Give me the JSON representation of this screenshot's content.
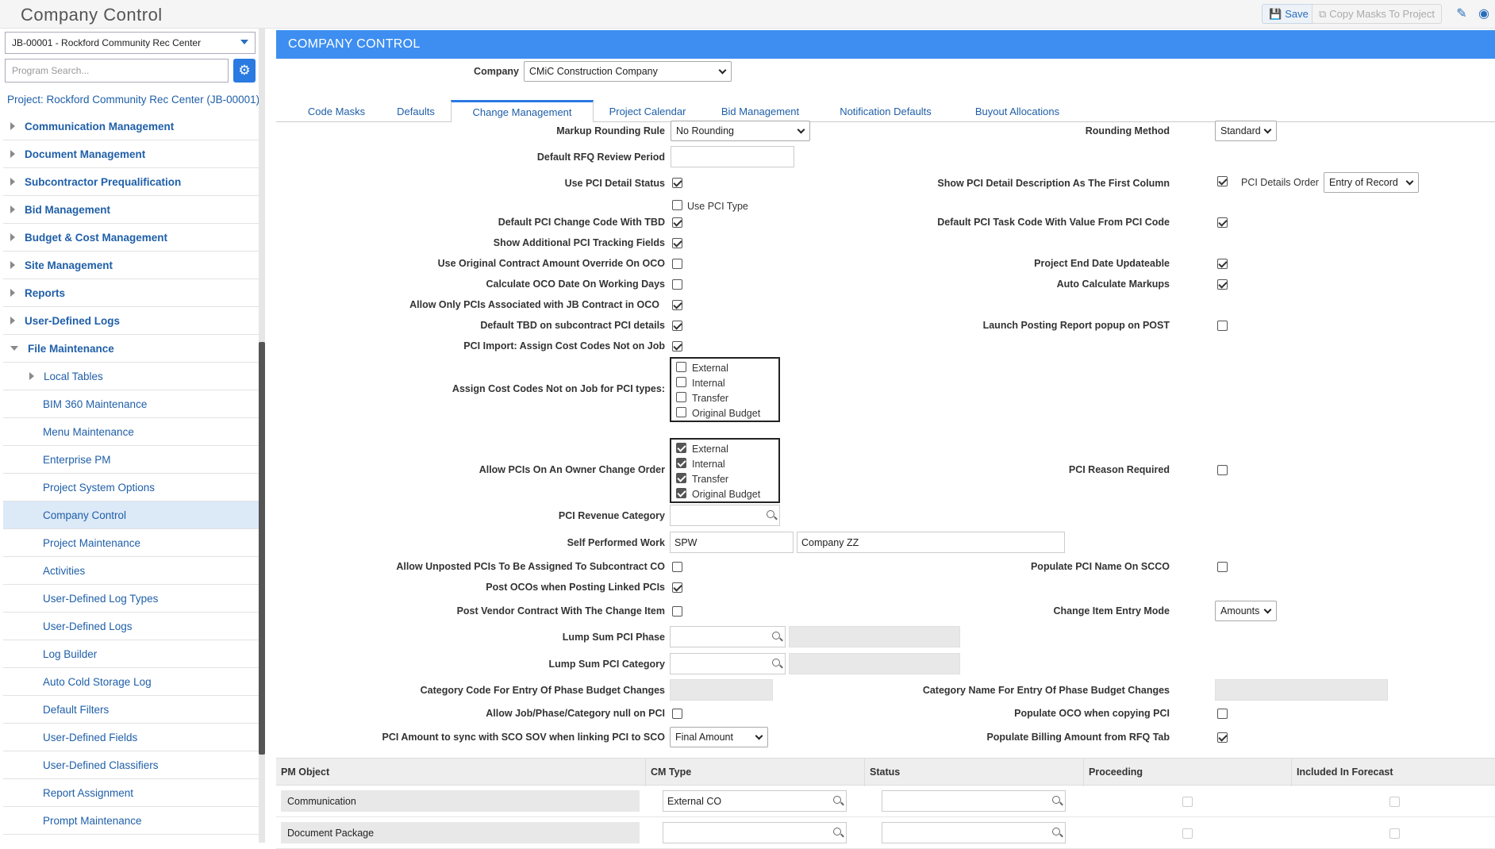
{
  "app": {
    "title": "Company Control",
    "save_label": "Save",
    "copy_masks_label": "Copy Masks To Project"
  },
  "sidebar": {
    "project_select": "JB-00001 - Rockford Community Rec Center",
    "search_placeholder": "Program Search...",
    "project_link": "Project: Rockford Community Rec Center (JB-00001)",
    "items": [
      {
        "label": "Communication Management"
      },
      {
        "label": "Document Management"
      },
      {
        "label": "Subcontractor Prequalification"
      },
      {
        "label": "Bid Management"
      },
      {
        "label": "Budget & Cost Management"
      },
      {
        "label": "Site Management"
      },
      {
        "label": "Reports"
      },
      {
        "label": "User-Defined Logs"
      },
      {
        "label": "File Maintenance"
      }
    ],
    "sub_items": [
      {
        "label": "Local Tables"
      },
      {
        "label": "BIM 360 Maintenance"
      },
      {
        "label": "Menu Maintenance"
      },
      {
        "label": "Enterprise PM"
      },
      {
        "label": "Project System Options"
      },
      {
        "label": "Company Control"
      },
      {
        "label": "Project Maintenance"
      },
      {
        "label": "Activities"
      },
      {
        "label": "User-Defined Log Types"
      },
      {
        "label": "User-Defined Logs"
      },
      {
        "label": "Log Builder"
      },
      {
        "label": "Auto Cold Storage Log"
      },
      {
        "label": "Default Filters"
      },
      {
        "label": "User-Defined Fields"
      },
      {
        "label": "User-Defined Classifiers"
      },
      {
        "label": "Report Assignment"
      },
      {
        "label": "Prompt Maintenance"
      }
    ]
  },
  "main": {
    "header": "COMPANY CONTROL",
    "company_label": "Company",
    "company_value": "CMiC Construction Company",
    "tabs": [
      "Code Masks",
      "Defaults",
      "Change Management",
      "Project Calendar",
      "Bid Management",
      "Notification Defaults",
      "Buyout Allocations"
    ],
    "fields": {
      "markup_rounding_rule": {
        "label": "Markup Rounding Rule",
        "value": "No Rounding"
      },
      "rounding_method": {
        "label": "Rounding Method",
        "value": "Standard"
      },
      "default_rfq_review_period": {
        "label": "Default RFQ Review Period"
      },
      "use_pci_detail_status": {
        "label": "Use PCI Detail Status"
      },
      "show_pci_detail_desc": {
        "label": "Show PCI Detail Description As The First Column"
      },
      "pci_details_order": {
        "label": "PCI Details Order",
        "value": "Entry of Record"
      },
      "use_pci_type": {
        "label": "Use PCI Type"
      },
      "default_pci_change_code_tbd": {
        "label": "Default PCI Change Code With TBD"
      },
      "default_pci_task_code": {
        "label": "Default PCI Task Code With Value From PCI Code"
      },
      "show_additional_pci_tracking": {
        "label": "Show Additional PCI Tracking Fields"
      },
      "use_original_contract_amount": {
        "label": "Use Original Contract Amount Override On OCO"
      },
      "project_end_date_updateable": {
        "label": "Project End Date Updateable"
      },
      "calculate_oco_date": {
        "label": "Calculate OCO Date On Working Days"
      },
      "auto_calculate_markups": {
        "label": "Auto Calculate Markups"
      },
      "allow_only_pcis_jb": {
        "label": "Allow Only PCIs Associated with JB Contract in OCO"
      },
      "default_tbd_subcontract": {
        "label": "Default TBD on subcontract PCI details"
      },
      "launch_posting_report": {
        "label": "Launch Posting Report popup on POST"
      },
      "pci_import_assign": {
        "label": "PCI Import: Assign Cost Codes Not on Job"
      },
      "assign_cost_codes_types": {
        "label": "Assign Cost Codes Not on Job for PCI types:"
      },
      "allow_pcis_owner_change": {
        "label": "Allow PCIs On An Owner Change Order"
      },
      "pci_reason_required": {
        "label": "PCI Reason Required"
      },
      "pci_revenue_category": {
        "label": "PCI Revenue Category"
      },
      "self_performed_work": {
        "label": "Self Performed Work",
        "code": "SPW",
        "name": "Company ZZ"
      },
      "allow_unposted_pcis": {
        "label": "Allow Unposted PCIs To Be Assigned To Subcontract CO"
      },
      "populate_pci_name_scco": {
        "label": "Populate PCI Name On SCCO"
      },
      "post_ocos_linked": {
        "label": "Post OCOs when Posting Linked PCIs"
      },
      "post_vendor_contract": {
        "label": "Post Vendor Contract With The Change Item"
      },
      "change_item_entry_mode": {
        "label": "Change Item Entry Mode",
        "value": "Amounts"
      },
      "lump_sum_pci_phase": {
        "label": "Lump Sum PCI Phase"
      },
      "lump_sum_pci_category": {
        "label": "Lump Sum PCI Category"
      },
      "category_code_entry": {
        "label": "Category Code For Entry Of Phase Budget Changes"
      },
      "category_name_entry": {
        "label": "Category Name For Entry Of Phase Budget Changes"
      },
      "allow_job_phase_null": {
        "label": "Allow Job/Phase/Category null on PCI"
      },
      "populate_oco_copying": {
        "label": "Populate OCO when copying PCI"
      },
      "pci_amount_sync": {
        "label": "PCI Amount to sync with SCO SOV when linking PCI to SCO",
        "value": "Final Amount"
      },
      "populate_billing_amount": {
        "label": "Populate Billing Amount from RFQ Tab"
      }
    },
    "pci_types": [
      "External",
      "Internal",
      "Transfer",
      "Original Budget"
    ],
    "grid": {
      "columns": [
        "PM Object",
        "CM Type",
        "Status",
        "Proceeding",
        "Included In Forecast"
      ],
      "rows": [
        {
          "pm_object": "Communication",
          "cm_type": "External CO",
          "status": ""
        },
        {
          "pm_object": "Document Package",
          "cm_type": "",
          "status": ""
        }
      ]
    }
  }
}
